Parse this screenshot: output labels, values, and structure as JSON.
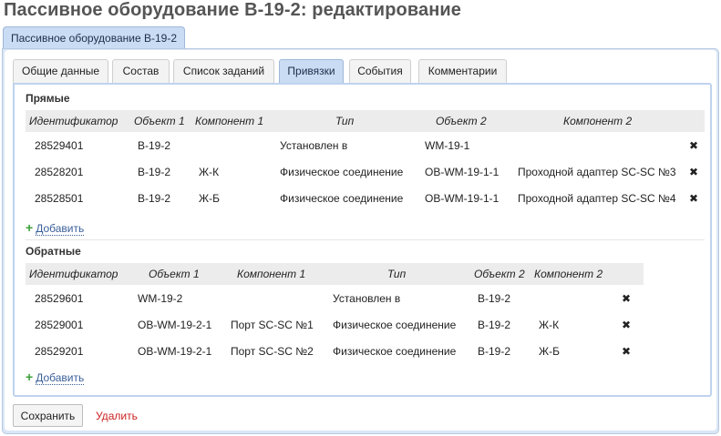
{
  "page": {
    "title": "Пассивное оборудование B-19-2: редактирование"
  },
  "outer_tab": {
    "label": "Пассивное оборудование B-19-2"
  },
  "tabs": [
    {
      "label": "Общие данные",
      "active": false
    },
    {
      "label": "Состав",
      "active": false
    },
    {
      "label": "Список заданий",
      "active": false
    },
    {
      "label": "Привязки",
      "active": true
    },
    {
      "label": "События",
      "active": false
    },
    {
      "label": "Комментарии",
      "active": false
    }
  ],
  "direct": {
    "title": "Прямые",
    "columns": [
      "Идентификатор",
      "Объект 1",
      "Компонент 1",
      "Тип",
      "Объект 2",
      "Компонент 2"
    ],
    "rows": [
      {
        "id": "28529401",
        "obj1": "B-19-2",
        "comp1": "",
        "type": "Установлен в",
        "obj2": "WM-19-1",
        "comp2": ""
      },
      {
        "id": "28528201",
        "obj1": "B-19-2",
        "comp1": "Ж-К",
        "type": "Физическое соединение",
        "obj2": "OB-WM-19-1-1",
        "comp2": "Проходной адаптер SC-SC №3"
      },
      {
        "id": "28528501",
        "obj1": "B-19-2",
        "comp1": "Ж-Б",
        "type": "Физическое соединение",
        "obj2": "OB-WM-19-1-1",
        "comp2": "Проходной адаптер SC-SC №4"
      }
    ],
    "add_label": "Добавить"
  },
  "reverse": {
    "title": "Обратные",
    "columns": [
      "Идентификатор",
      "Объект 1",
      "Компонент 1",
      "Тип",
      "Объект 2",
      "Компонент 2"
    ],
    "rows": [
      {
        "id": "28529601",
        "obj1": "WM-19-2",
        "comp1": "",
        "type": "Установлен в",
        "obj2": "B-19-2",
        "comp2": ""
      },
      {
        "id": "28529001",
        "obj1": "OB-WM-19-2-1",
        "comp1": "Порт SC-SC №1",
        "type": "Физическое соединение",
        "obj2": "B-19-2",
        "comp2": "Ж-К"
      },
      {
        "id": "28529201",
        "obj1": "OB-WM-19-2-1",
        "comp1": "Порт SC-SC №2",
        "type": "Физическое соединение",
        "obj2": "B-19-2",
        "comp2": "Ж-Б"
      }
    ],
    "add_label": "Добавить"
  },
  "actions": {
    "save_label": "Сохранить",
    "delete_label": "Удалить"
  },
  "icons": {
    "delete": "close-icon",
    "add": "plus-icon"
  },
  "colors": {
    "accent_tab": "#c9dcf3",
    "panel_bg": "#dbe7f5",
    "delete_link": "#cc2222",
    "add_plus": "#3aa03a"
  }
}
